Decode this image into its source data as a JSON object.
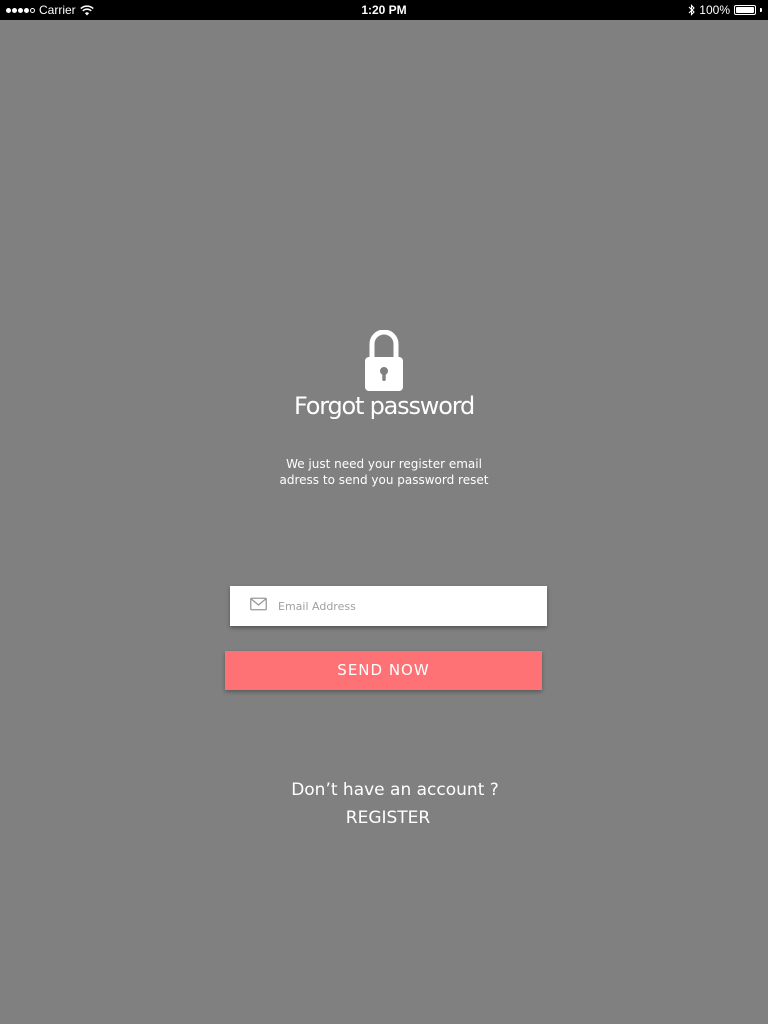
{
  "status_bar": {
    "carrier": "Carrier",
    "time": "1:20 PM",
    "battery_percent": "100%",
    "battery_level": 1.0,
    "signal_bars_filled": 4,
    "signal_bars_total": 5,
    "icons": [
      "wifi-icon",
      "bluetooth-icon",
      "battery-icon"
    ]
  },
  "main": {
    "icon": "lock-icon",
    "title": "Forgot password",
    "subtitle_lines": [
      "We just need your register email",
      "adress to send you password reset"
    ],
    "email": {
      "icon": "mail-icon",
      "value": "",
      "placeholder": "Email Address"
    },
    "send_button_label": "SEND NOW",
    "account_prompt": "Don’t have an account ?",
    "register_label": "REGISTER"
  },
  "colors": {
    "background": "#808080",
    "status_bar": "#000000",
    "accent": "#fe7276",
    "text": "#ffffff"
  }
}
